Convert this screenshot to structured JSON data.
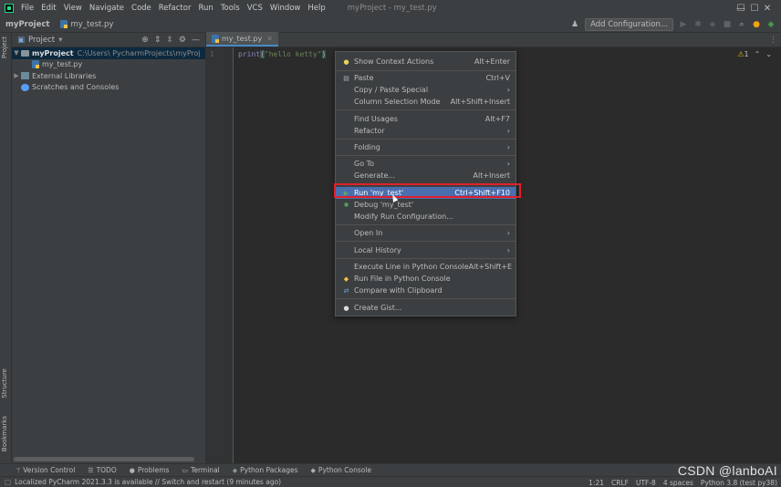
{
  "menu": [
    "File",
    "Edit",
    "View",
    "Navigate",
    "Code",
    "Refactor",
    "Run",
    "Tools",
    "VCS",
    "Window",
    "Help"
  ],
  "window_title": "myProject - my_test.py",
  "window_controls": {
    "minimize": "—",
    "maximize": "☐",
    "close": "✕"
  },
  "breadcrumb": {
    "project": "myProject",
    "file": "my_test.py"
  },
  "toolbar": {
    "add_config_label": "Add Configuration..."
  },
  "project_panel": {
    "title": "Project",
    "tree": [
      {
        "name": "myProject",
        "detail": "C:\\Users\\            PycharmProjects\\myProj"
      },
      {
        "name": "my_test.py"
      },
      {
        "name": "External Libraries"
      },
      {
        "name": "Scratches and Consoles"
      }
    ]
  },
  "left_tabs": {
    "project": "Project",
    "structure": "Structure",
    "bookmarks": "Bookmarks"
  },
  "editor": {
    "tab_label": "my_test.py",
    "line_number": "1",
    "code": {
      "fn": "print",
      "open": "(",
      "str": "\"hello ketty\"",
      "close": ")"
    },
    "warning_count": "1"
  },
  "context_menu": {
    "items": [
      {
        "label": "Show Context Actions",
        "shortcut": "Alt+Enter"
      },
      {
        "label": "Paste",
        "shortcut": "Ctrl+V"
      },
      {
        "label": "Copy / Paste Special",
        "shortcut": ""
      },
      {
        "label": "Column Selection Mode",
        "shortcut": "Alt+Shift+Insert"
      },
      {
        "label": "Find Usages",
        "shortcut": "Alt+F7"
      },
      {
        "label": "Refactor",
        "shortcut": ""
      },
      {
        "label": "Folding",
        "shortcut": ""
      },
      {
        "label": "Go To",
        "shortcut": ""
      },
      {
        "label": "Generate...",
        "shortcut": "Alt+Insert"
      },
      {
        "label": "Run 'my_test'",
        "shortcut": "Ctrl+Shift+F10"
      },
      {
        "label": "Debug 'my_test'",
        "shortcut": ""
      },
      {
        "label": "Modify Run Configuration...",
        "shortcut": ""
      },
      {
        "label": "Open In",
        "shortcut": ""
      },
      {
        "label": "Local History",
        "shortcut": ""
      },
      {
        "label": "Execute Line in Python Console",
        "shortcut": "Alt+Shift+E"
      },
      {
        "label": "Run File in Python Console",
        "shortcut": ""
      },
      {
        "label": "Compare with Clipboard",
        "shortcut": ""
      },
      {
        "label": "Create Gist...",
        "shortcut": ""
      }
    ]
  },
  "tool_windows": [
    "Version Control",
    "TODO",
    "Problems",
    "Terminal",
    "Python Packages",
    "Python Console"
  ],
  "status": {
    "message": "Localized PyCharm 2021.3.3 is available // Switch and restart (9 minutes ago)",
    "position": "1:21",
    "line_sep": "CRLF",
    "encoding": "UTF-8",
    "indent": "4 spaces",
    "interpreter": "Python 3.8 (test py38)"
  },
  "watermark": "CSDN @lanboAI",
  "colors": {
    "highlight": "#4b6eaf",
    "annotation_box": "#e0202a",
    "accent": "#4a88c7"
  }
}
